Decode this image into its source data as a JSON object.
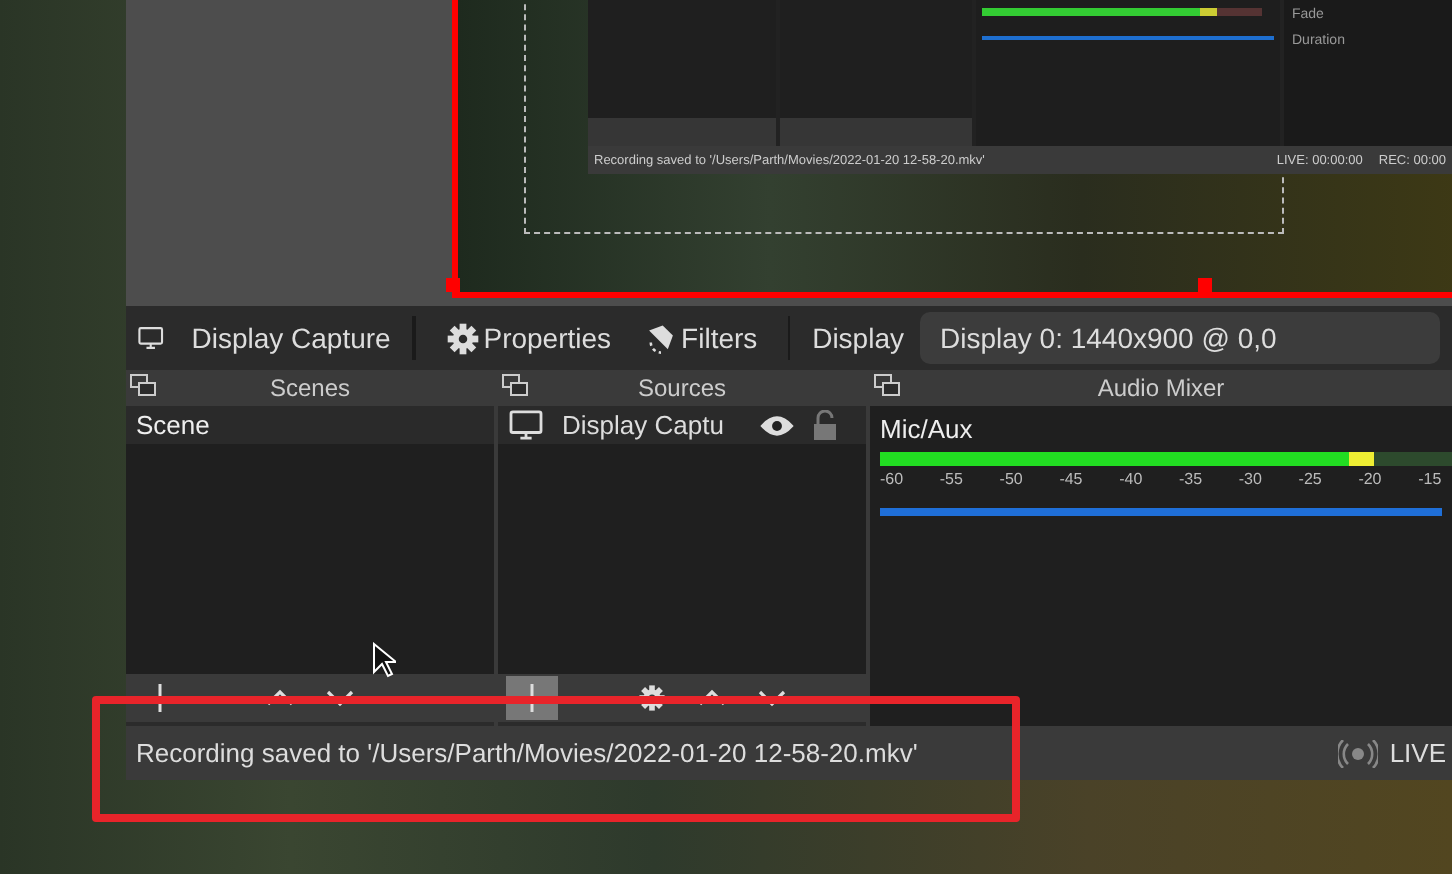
{
  "preview": {
    "nested_window": {
      "status_text": "Recording saved to '/Users/Parth/Movies/2022-01-20 12-58-20.mkv'",
      "live": "LIVE: 00:00:00",
      "rec": "REC: 00:00",
      "side_labels": [
        "Fade",
        "Duration"
      ]
    }
  },
  "source_toolbar": {
    "source_name": "Display Capture",
    "properties": "Properties",
    "filters": "Filters",
    "display_label": "Display",
    "display_select": "Display 0: 1440x900 @ 0,0"
  },
  "scenes": {
    "title": "Scenes",
    "items": [
      {
        "label": "Scene",
        "selected": false
      }
    ],
    "buttons": [
      {
        "kind": "add",
        "pressed": false
      },
      {
        "kind": "up",
        "pressed": false
      },
      {
        "kind": "down",
        "pressed": false
      }
    ]
  },
  "sources": {
    "title": "Sources",
    "items": [
      {
        "label": "Display Captu",
        "visible": true,
        "locked": false
      }
    ],
    "buttons": [
      {
        "kind": "add",
        "pressed": true
      },
      {
        "kind": "settings",
        "pressed": false
      },
      {
        "kind": "up",
        "pressed": false
      },
      {
        "kind": "down",
        "pressed": false
      }
    ]
  },
  "audio_mixer": {
    "title": "Audio Mixer",
    "channels": [
      {
        "name": "Mic/Aux",
        "level": 0.55,
        "fader": {
          "level": 1
        },
        "ticks": [
          "-60",
          "-55",
          "-50",
          "-45",
          "-40",
          "-35",
          "-30",
          "-25",
          "-20",
          "-15"
        ]
      }
    ]
  },
  "status_bar": {
    "message": "Recording saved to '/Users/Parth/Movies/2022-01-20 12-58-20.mkv'",
    "live": "LIVE"
  }
}
